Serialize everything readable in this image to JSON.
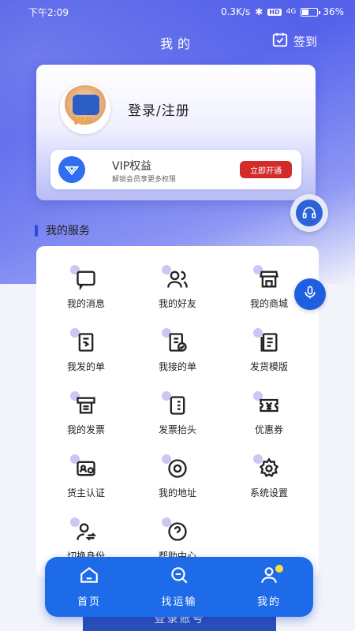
{
  "status_bar": {
    "time": "下午2:09",
    "network_speed": "0.3K/s",
    "hd_badge": "HD",
    "signal": "4G",
    "battery": "36%"
  },
  "header": {
    "title": "我的",
    "checkin_label": "签到"
  },
  "profile": {
    "login_label": "登录/注册",
    "avatar_badge": "VIP",
    "vip": {
      "title": "VIP权益",
      "subtitle": "解锁会员享更多权限",
      "button": "立即开通"
    }
  },
  "services": {
    "title": "我的服务",
    "items": [
      {
        "label": "我的消息",
        "icon": "message-icon"
      },
      {
        "label": "我的好友",
        "icon": "friends-icon"
      },
      {
        "label": "我的商城",
        "icon": "store-icon"
      },
      {
        "label": "我发的单",
        "icon": "sent-order-icon"
      },
      {
        "label": "我接的单",
        "icon": "received-order-icon"
      },
      {
        "label": "发货模版",
        "icon": "template-icon"
      },
      {
        "label": "我的发票",
        "icon": "invoice-icon"
      },
      {
        "label": "发票抬头",
        "icon": "invoice-header-icon"
      },
      {
        "label": "优惠券",
        "icon": "coupon-icon"
      },
      {
        "label": "货主认证",
        "icon": "certification-icon"
      },
      {
        "label": "我的地址",
        "icon": "location-icon"
      },
      {
        "label": "系统设置",
        "icon": "settings-icon"
      },
      {
        "label": "切换身份",
        "icon": "switch-identity-icon"
      },
      {
        "label": "帮助中心",
        "icon": "help-icon"
      }
    ]
  },
  "login_account": "登录账号",
  "tabbar": {
    "items": [
      {
        "label": "首页",
        "icon": "home-icon"
      },
      {
        "label": "找运输",
        "icon": "search-transport-icon"
      },
      {
        "label": "我的",
        "icon": "profile-icon"
      }
    ]
  },
  "colors": {
    "primary": "#4a57e6",
    "tabbar": "#1e6bea",
    "vip_button": "#d32a2a"
  }
}
